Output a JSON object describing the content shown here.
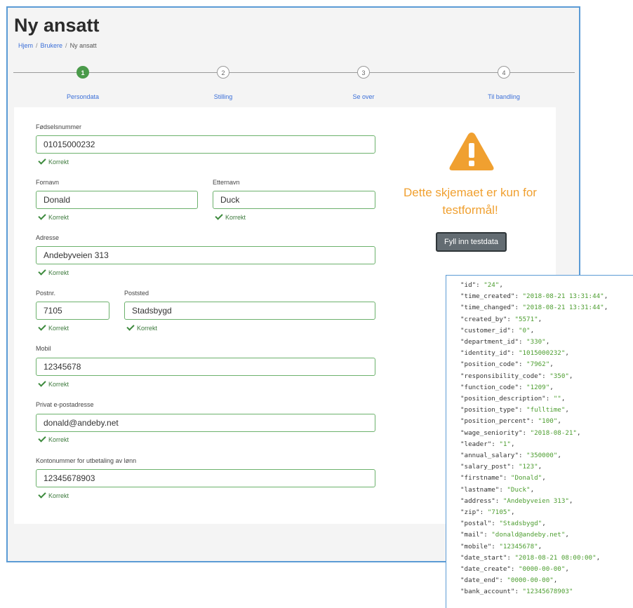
{
  "page": {
    "title": "Ny ansatt"
  },
  "breadcrumb": {
    "home": "Hjem",
    "users": "Brukere",
    "current": "Ny ansatt",
    "separator": "/"
  },
  "stepper": {
    "steps": [
      {
        "number": "1",
        "label": "Persondata",
        "active": true
      },
      {
        "number": "2",
        "label": "Stilling",
        "active": false
      },
      {
        "number": "3",
        "label": "Se over",
        "active": false
      },
      {
        "number": "4",
        "label": "Til bandling",
        "active": false
      }
    ]
  },
  "form": {
    "valid_text": "Korrekt",
    "ssn": {
      "label": "Fødselsnummer",
      "value": "01015000232"
    },
    "firstname": {
      "label": "Fornavn",
      "value": "Donald"
    },
    "lastname": {
      "label": "Etternavn",
      "value": "Duck"
    },
    "address": {
      "label": "Adresse",
      "value": "Andebyveien 313"
    },
    "zip": {
      "label": "Postnr.",
      "value": "7105"
    },
    "city": {
      "label": "Poststed",
      "value": "Stadsbygd"
    },
    "mobile": {
      "label": "Mobil",
      "value": "12345678"
    },
    "email": {
      "label": "Privat e-postadresse",
      "value": "donald@andeby.net"
    },
    "bank": {
      "label": "Kontonummer for utbetaling av lønn",
      "value": "12345678903"
    }
  },
  "notice": {
    "text": "Dette skjemaet er kun for testformål!",
    "button_label": "Fyll inn testdata",
    "icon": "warning-triangle-icon",
    "color": "#f0a030"
  },
  "json_output": [
    {
      "key": "id",
      "value": "24"
    },
    {
      "key": "time_created",
      "value": "2018-08-21 13:31:44"
    },
    {
      "key": "time_changed",
      "value": "2018-08-21 13:31:44"
    },
    {
      "key": "created_by",
      "value": "5571"
    },
    {
      "key": "customer_id",
      "value": "0"
    },
    {
      "key": "department_id",
      "value": "330"
    },
    {
      "key": "identity_id",
      "value": "1015000232"
    },
    {
      "key": "position_code",
      "value": "7962"
    },
    {
      "key": "responsibility_code",
      "value": "350"
    },
    {
      "key": "function_code",
      "value": "1209"
    },
    {
      "key": "position_description",
      "value": ""
    },
    {
      "key": "position_type",
      "value": "fulltime"
    },
    {
      "key": "position_percent",
      "value": "100"
    },
    {
      "key": "wage_seniority",
      "value": "2018-08-21"
    },
    {
      "key": "leader",
      "value": "1"
    },
    {
      "key": "annual_salary",
      "value": "350000"
    },
    {
      "key": "salary_post",
      "value": "123"
    },
    {
      "key": "firstname",
      "value": "Donald"
    },
    {
      "key": "lastname",
      "value": "Duck"
    },
    {
      "key": "address",
      "value": "Andebyveien 313"
    },
    {
      "key": "zip",
      "value": "7105"
    },
    {
      "key": "postal",
      "value": "Stadsbygd"
    },
    {
      "key": "mail",
      "value": "donald@andeby.net"
    },
    {
      "key": "mobile",
      "value": "12345678"
    },
    {
      "key": "date_start",
      "value": "2018-08-21 08:00:00"
    },
    {
      "key": "date_create",
      "value": "0000-00-00"
    },
    {
      "key": "date_end",
      "value": "0000-00-00"
    },
    {
      "key": "bank_account",
      "value": "12345678903"
    }
  ],
  "colors": {
    "accent": "#3b6fd8",
    "valid": "#3d7a3d",
    "active_step": "#4a9a4a",
    "json_value": "#4c9d2f"
  }
}
